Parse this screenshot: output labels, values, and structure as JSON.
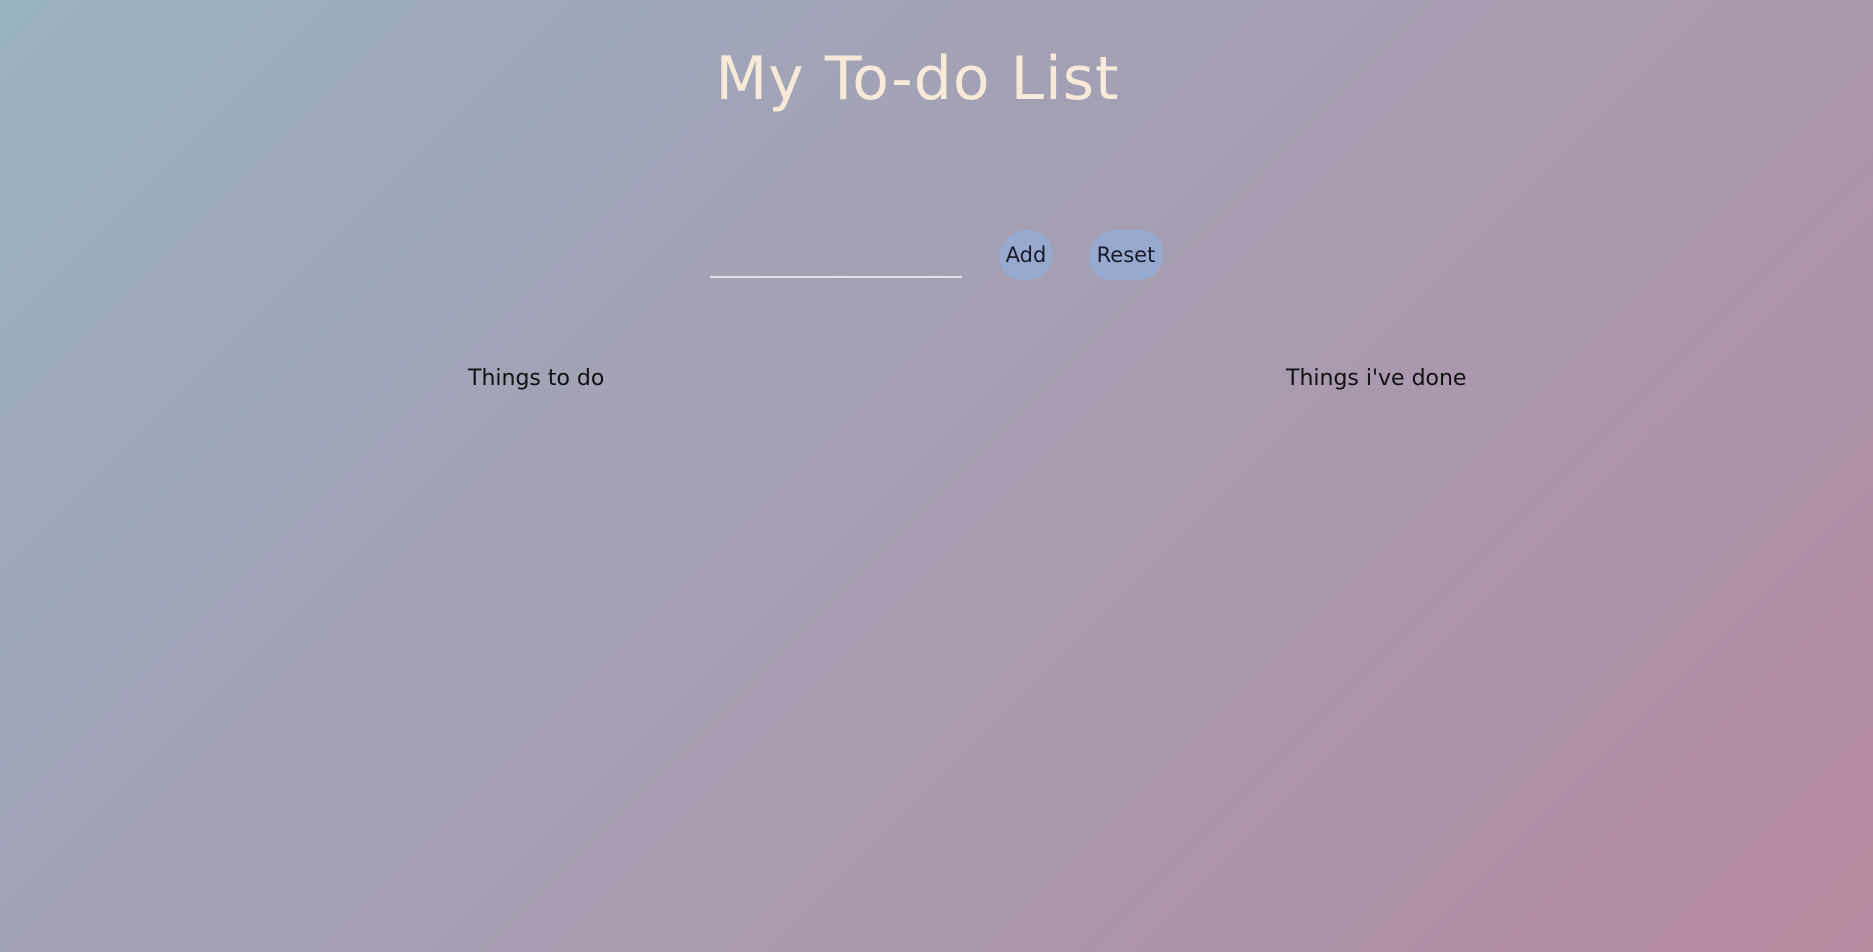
{
  "header": {
    "title": "My To-do List"
  },
  "form": {
    "input_value": "",
    "input_placeholder": "",
    "add_label": "Add",
    "reset_label": "Reset"
  },
  "columns": {
    "todo_heading": "Things to do",
    "done_heading": "Things i've done"
  },
  "colors": {
    "title": "#f8ead8",
    "button_bg": "#98a9d0",
    "background_start": "#98b2c2",
    "background_end": "#b68a9f"
  }
}
